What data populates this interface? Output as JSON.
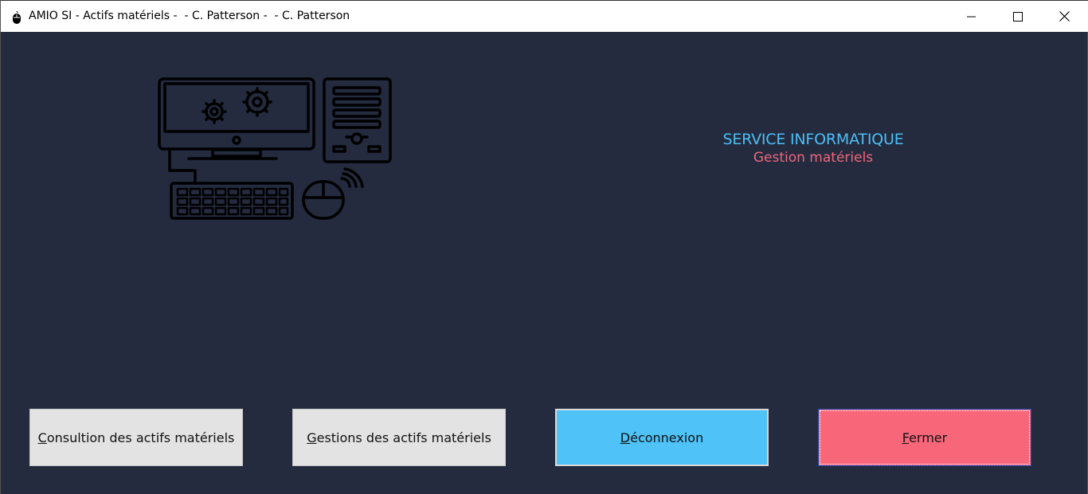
{
  "window": {
    "title": "AMIO SI - Actifs matériels -  - C. Patterson -  - C. Patterson",
    "icon": "mouse-icon",
    "controls": {
      "minimize": "minimize-icon",
      "maximize": "maximize-icon",
      "close": "close-icon"
    }
  },
  "colors": {
    "background": "#242b3f",
    "heading_main": "#4dbef5",
    "heading_sub": "#f0657a",
    "button_gray": "#e3e3e3",
    "button_blue": "#4fc2f7",
    "button_red": "#f8667a"
  },
  "illustration": {
    "icon": "computer-workstation-icon"
  },
  "heading": {
    "title": "SERVICE INFORMATIQUE",
    "subtitle": "Gestion matériels"
  },
  "buttons": {
    "consultation": {
      "first": "C",
      "rest": "onsultion des actifs matériels"
    },
    "gestion": {
      "first": "G",
      "rest": "estions des actifs matériels"
    },
    "deconnexion": {
      "first": "D",
      "rest": "éconnexion"
    },
    "fermer": {
      "first": "F",
      "rest": "ermer"
    }
  }
}
